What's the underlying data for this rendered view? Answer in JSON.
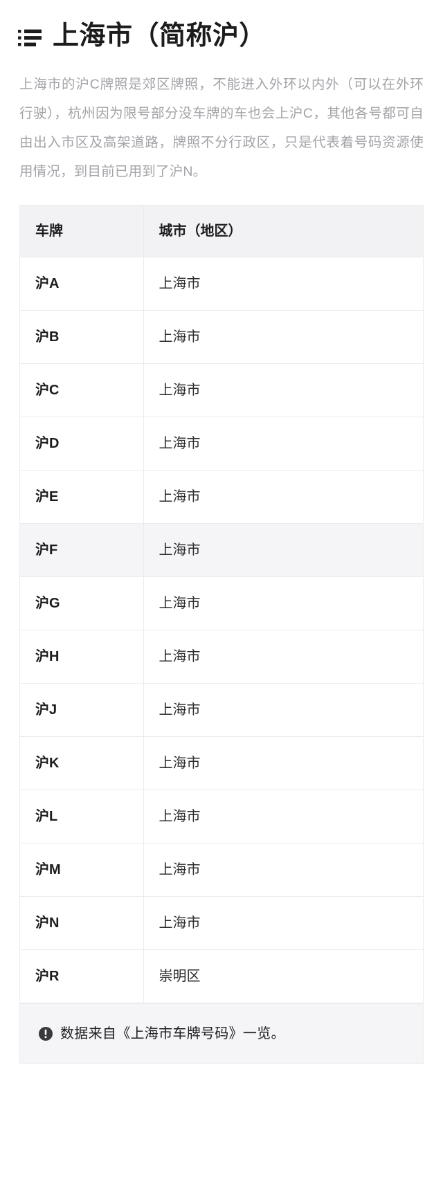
{
  "header": {
    "icon": "list-icon",
    "title": "上海市（简称沪）"
  },
  "intro": {
    "paragraph": "上海市的沪C牌照是郊区牌照，不能进入外环以内外（可以在外环行驶），杭州因为限号部分没车牌的车也会上沪C，其他各号都可自由出入市区及高架道路，牌照不分行政区，只是代表着号码资源使用情况，到目前已用到了沪N。"
  },
  "table": {
    "columns": [
      "车牌",
      "城市（地区）"
    ],
    "rows": [
      {
        "plate": "沪A",
        "city": "上海市",
        "highlight": false
      },
      {
        "plate": "沪B",
        "city": "上海市",
        "highlight": false
      },
      {
        "plate": "沪C",
        "city": "上海市",
        "highlight": false
      },
      {
        "plate": "沪D",
        "city": "上海市",
        "highlight": false
      },
      {
        "plate": "沪E",
        "city": "上海市",
        "highlight": false
      },
      {
        "plate": "沪F",
        "city": "上海市",
        "highlight": true
      },
      {
        "plate": "沪G",
        "city": "上海市",
        "highlight": false
      },
      {
        "plate": "沪H",
        "city": "上海市",
        "highlight": false
      },
      {
        "plate": "沪J",
        "city": "上海市",
        "highlight": false
      },
      {
        "plate": "沪K",
        "city": "上海市",
        "highlight": false
      },
      {
        "plate": "沪L",
        "city": "上海市",
        "highlight": false
      },
      {
        "plate": "沪M",
        "city": "上海市",
        "highlight": false
      },
      {
        "plate": "沪N",
        "city": "上海市",
        "highlight": false
      },
      {
        "plate": "沪R",
        "city": "崇明区",
        "highlight": false
      }
    ]
  },
  "footer": {
    "icon": "exclamation-circle-icon",
    "text": "数据来自《上海市车牌号码》一览。"
  },
  "colors": {
    "page_background": "#ffffff",
    "title_text": "#1c1c1e",
    "intro_text": "#a3a3a8",
    "table_header_background": "#f2f2f5",
    "table_border": "#eceaee",
    "row_highlight_background": "#f5f5f7",
    "footer_background": "#f5f5f7",
    "icon_dark": "#2b2b2b"
  }
}
